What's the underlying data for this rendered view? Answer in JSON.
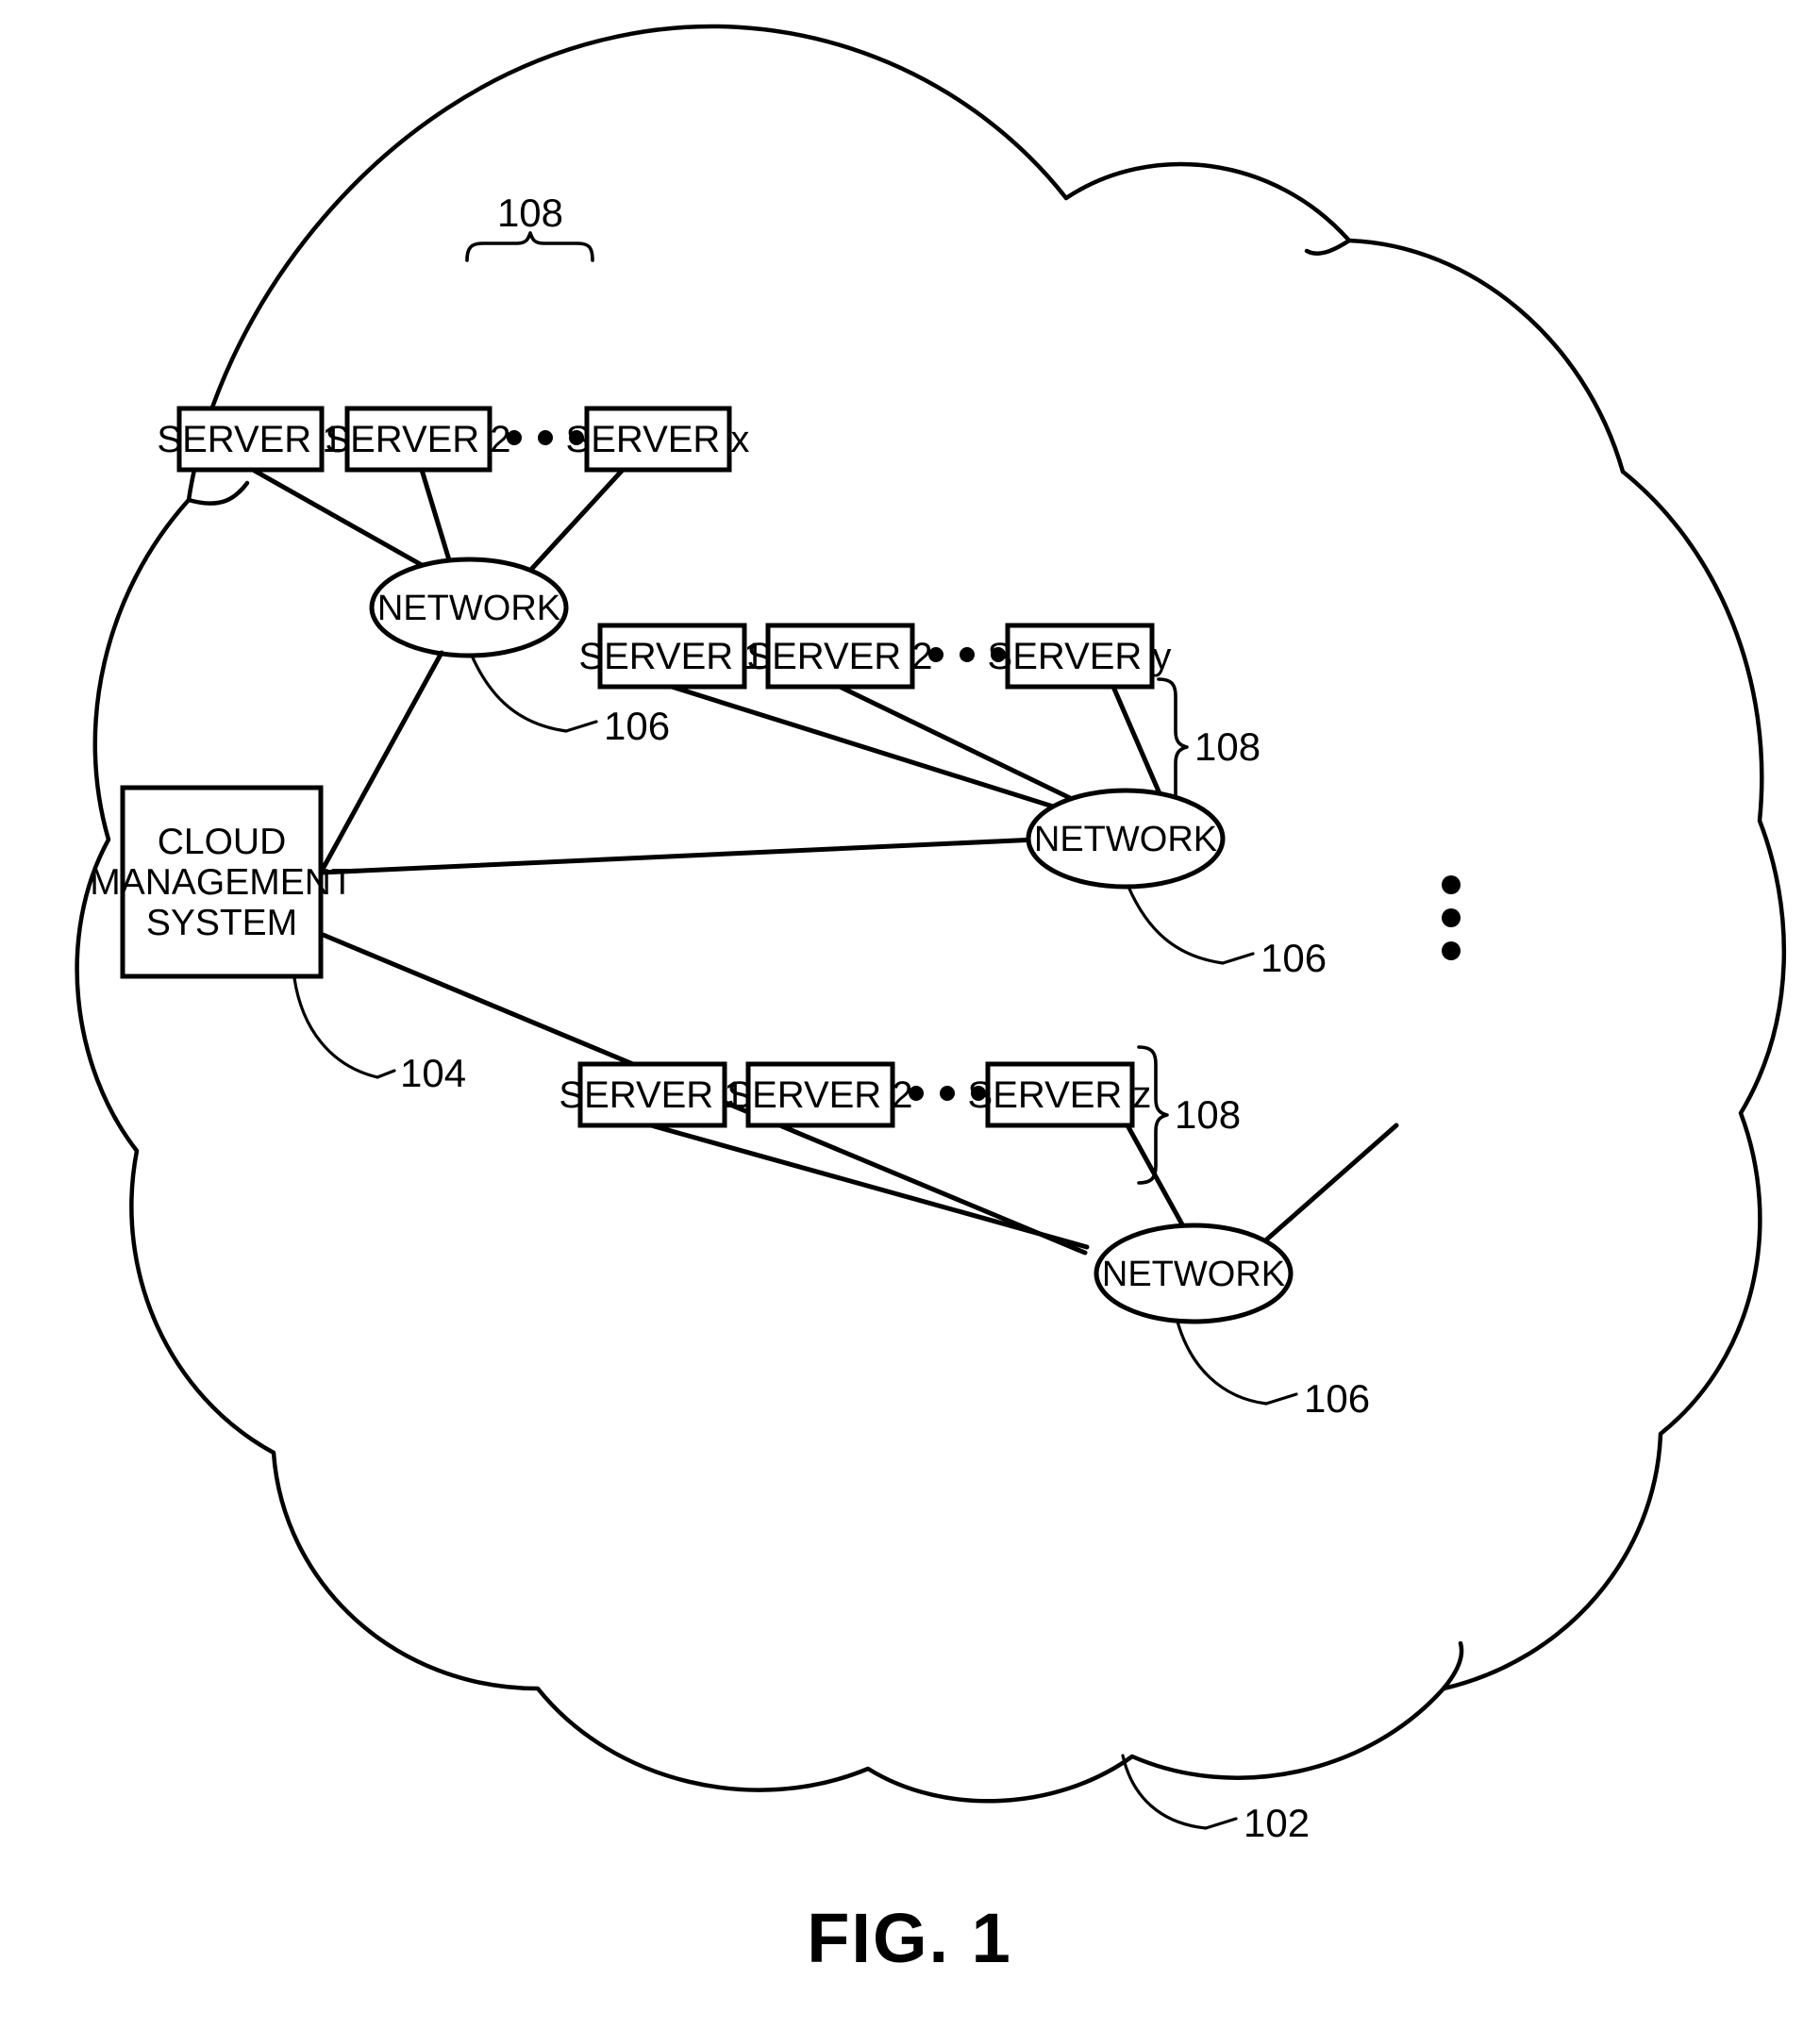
{
  "figure": {
    "caption": "FIG. 1",
    "cloud_ref": "102"
  },
  "cloud_management_system": {
    "line1": "CLOUD",
    "line2": "MANAGEMENT",
    "line3": "SYSTEM",
    "ref": "104"
  },
  "network_label": "NETWORK",
  "ellipsis_horizontal": "• • •",
  "ellipsis_vertical": "⋮",
  "groups": [
    {
      "id": "group-1",
      "servers": [
        "SERVER 1",
        "SERVER 2",
        "SERVER x"
      ],
      "server_group_ref": "108",
      "network_label": "NETWORK",
      "network_ref": "106"
    },
    {
      "id": "group-2",
      "servers": [
        "SERVER 1",
        "SERVER 2",
        "SERVER y"
      ],
      "server_group_ref": "108",
      "network_label": "NETWORK",
      "network_ref": "106"
    },
    {
      "id": "group-3",
      "servers": [
        "SERVER 1",
        "SERVER 2",
        "SERVER z"
      ],
      "server_group_ref": "108",
      "network_label": "NETWORK",
      "network_ref": "106"
    }
  ],
  "colors": {
    "ink": "#000000",
    "paper": "#ffffff"
  }
}
